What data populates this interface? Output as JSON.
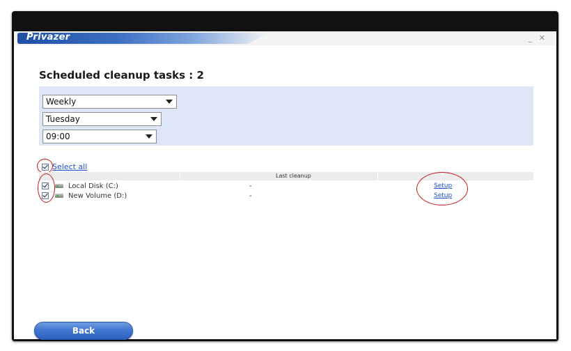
{
  "app": {
    "brand": "Privazer"
  },
  "window": {
    "minimize": "_",
    "close": "✕"
  },
  "page": {
    "title": "Scheduled cleanup tasks : 2"
  },
  "schedule": {
    "frequency": "Weekly",
    "day": "Tuesday",
    "time": "09:00"
  },
  "select_all": {
    "label": "Select all",
    "checked": true
  },
  "table": {
    "columns": [
      "",
      "Last cleanup",
      ""
    ],
    "rows": [
      {
        "name": "Local Disk (C:)",
        "last_cleanup": "-",
        "action": "Setup",
        "checked": true
      },
      {
        "name": "New Volume (D:)",
        "last_cleanup": "-",
        "action": "Setup",
        "checked": true
      }
    ]
  },
  "buttons": {
    "back": "Back"
  },
  "colors": {
    "panel_bg": "#dde7f8",
    "link": "#1d4fcf",
    "button": "#3f74cf",
    "annotation": "#c41b1b"
  },
  "icons": [
    "drive-icon",
    "checkbox-check-icon"
  ]
}
